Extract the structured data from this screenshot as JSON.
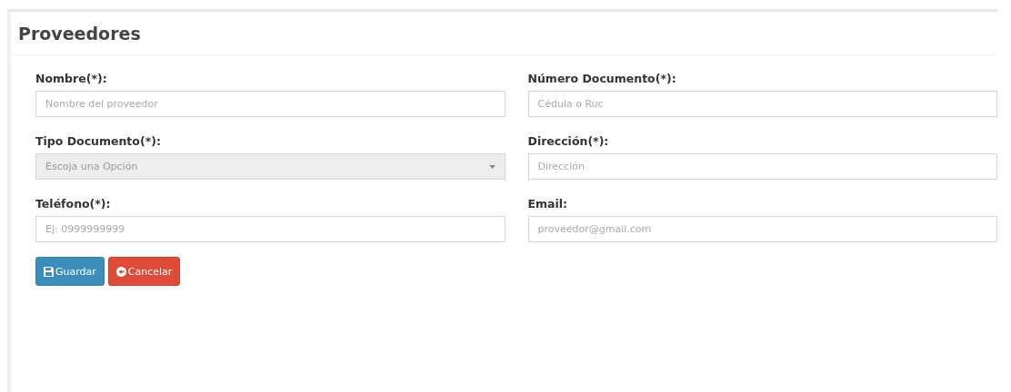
{
  "panel": {
    "title": "Proveedores"
  },
  "fields": [
    {
      "kind": "text",
      "label": "Nombre(*):",
      "placeholder": "Nombre del proveedor",
      "disabled": false
    },
    {
      "kind": "text",
      "label": "Número Documento(*):",
      "placeholder": "Cédula o Ruc",
      "disabled": false
    },
    {
      "kind": "select",
      "label": "Tipo Documento(*):",
      "placeholder": "Escoja una Opción",
      "disabled": true
    },
    {
      "kind": "text",
      "label": "Dirección(*):",
      "placeholder": "Dirección",
      "disabled": false
    },
    {
      "kind": "text",
      "label": "Teléfono(*):",
      "placeholder": "Ej: 0999999999",
      "disabled": false
    },
    {
      "kind": "text",
      "label": "Email:",
      "placeholder": "proveedor@gmail.com",
      "disabled": false
    }
  ],
  "buttons": [
    {
      "kind": "save",
      "label": "Guardar"
    },
    {
      "kind": "cancel",
      "label": "Cancelar"
    }
  ]
}
